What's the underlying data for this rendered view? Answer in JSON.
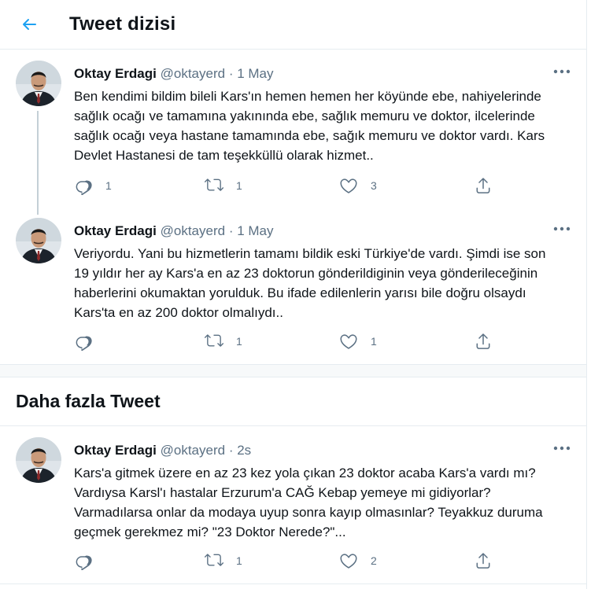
{
  "header": {
    "title": "Tweet dizisi"
  },
  "tweets": [
    {
      "author": "Oktay Erdagi",
      "handle": "@oktayerd",
      "dot": "·",
      "date": "1 May",
      "text": "Ben kendimi bildim bileli Kars'ın hemen hemen her köyünde ebe, nahiyelerinde sağlık ocağı ve tamamına yakınında ebe, sağlık memuru ve doktor, ilcelerinde sağlık ocağı veya hastane tamamında ebe, sağık memuru ve doktor vardı. Kars Devlet Hastanesi de tam teşekküllü olarak hizmet..",
      "replies": "1",
      "retweets": "1",
      "likes": "3"
    },
    {
      "author": "Oktay Erdagi",
      "handle": "@oktayerd",
      "dot": "·",
      "date": "1 May",
      "text": "Veriyordu. Yani bu hizmetlerin tamamı bildik eski Türkiye'de vardı. Şimdi ise son 19 yıldır her ay Kars'a en az 23 doktorun gönderildiginin veya gönderileceğinin haberlerini okumaktan yorulduk. Bu ifade edilenlerin yarısı bile doğru olsaydı Kars'ta en az 200 doktor olmalıydı..",
      "replies": "",
      "retweets": "1",
      "likes": "1"
    }
  ],
  "more_section": {
    "title": "Daha fazla Tweet"
  },
  "more_tweets": [
    {
      "author": "Oktay Erdagi",
      "handle": "@oktayerd",
      "dot": "·",
      "date": "2s",
      "text": "Kars'a gitmek üzere en az 23 kez yola çıkan 23 doktor acaba Kars'a vardı mı? Vardıysa Karsl'ı hastalar Erzurum'a CAĞ Kebap yemeye mi gidiyorlar? Varmadılarsa onlar da modaya uyup sonra kayıp olmasınlar? Teyakkuz duruma geçmek gerekmez mi? \"23 Doktor Nerede?\"...",
      "replies": "",
      "retweets": "1",
      "likes": "2"
    }
  ],
  "colors": {
    "accent": "#1da1f2",
    "secondary_text": "#5b7083",
    "border": "#e6ecf0"
  },
  "icons": {
    "back": "arrow-left-icon",
    "more": "more-horizontal-icon",
    "reply": "reply-icon",
    "retweet": "retweet-icon",
    "like": "heart-icon",
    "share": "share-icon"
  }
}
